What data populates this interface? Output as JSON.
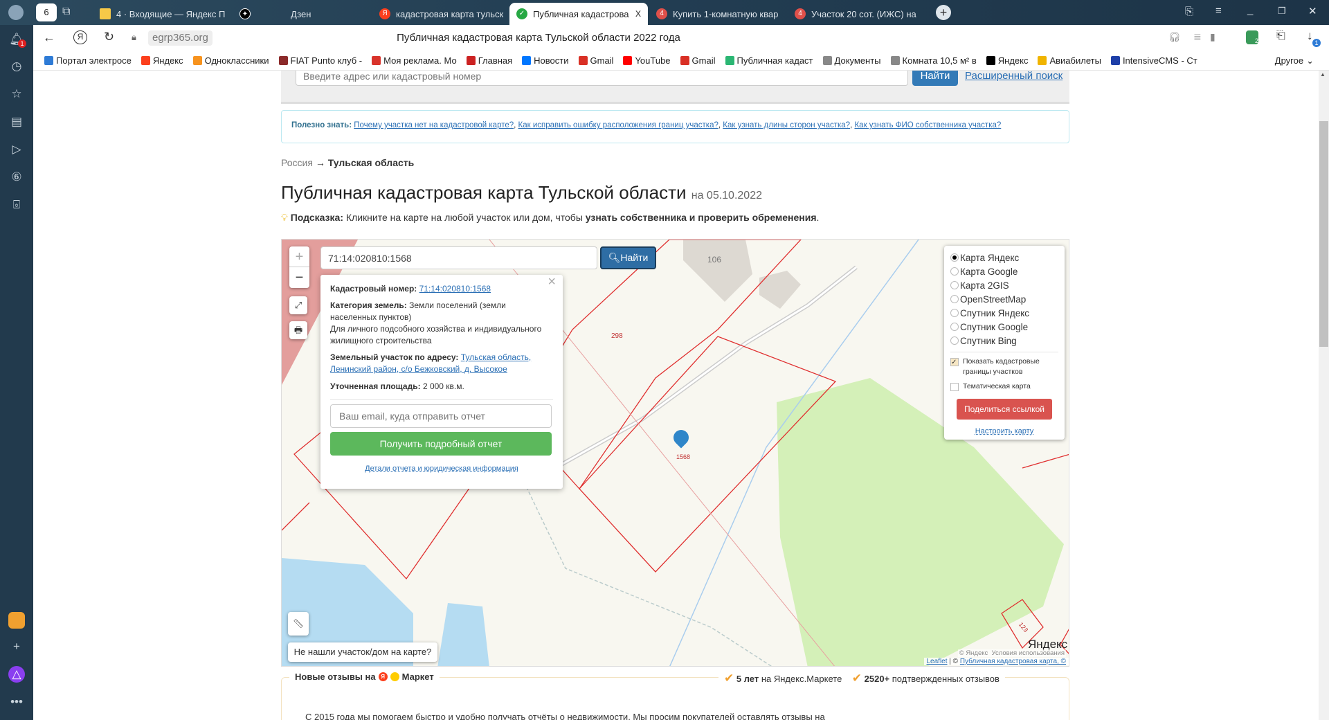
{
  "browser": {
    "tabs": [
      {
        "label": "4 · Входящие — Яндекс П",
        "color": "#f7c948"
      },
      {
        "label": "Дзен",
        "color": "#000000"
      },
      {
        "label": "кадастровая карта тульск",
        "color": "#fc3f1d"
      },
      {
        "label": "Публичная кадастрова",
        "color": "#27a844",
        "active": true
      },
      {
        "label": "Купить 1-комнатную квар",
        "color": "#e0504a"
      },
      {
        "label": "Участок 20 сот. (ИЖС) на",
        "color": "#e0504a"
      }
    ],
    "tab_close": "X",
    "url": "egrp365.org",
    "page_title": "Публичная кадастровая карта Тульской области 2022 года",
    "notification_count": "1",
    "download_count": "1",
    "ext_count": "2",
    "bookmarks": [
      {
        "label": "Портал электросе",
        "color": "#2e7bd6"
      },
      {
        "label": "Яндекс",
        "color": "#fc3f1d"
      },
      {
        "label": "Одноклассники",
        "color": "#f7931e"
      },
      {
        "label": "FIAT Punto клуб -",
        "color": "#8b2a2a"
      },
      {
        "label": "Моя реклама. Мо",
        "color": "#d9332b"
      },
      {
        "label": "Главная",
        "color": "#cc2222"
      },
      {
        "label": "Новости",
        "color": "#0077ff"
      },
      {
        "label": "Gmail",
        "color": "#d93025"
      },
      {
        "label": "YouTube",
        "color": "#ff0000"
      },
      {
        "label": "Gmail",
        "color": "#d93025"
      },
      {
        "label": "Публичная кадаст",
        "color": "#2bb673"
      },
      {
        "label": "Документы",
        "color": "#888888"
      },
      {
        "label": "Комната 10,5 м² в",
        "color": "#888888"
      },
      {
        "label": "Яндекс",
        "color": "#000000"
      },
      {
        "label": "Авиабилеты",
        "color": "#f0b400"
      },
      {
        "label": "IntensiveCMS - Ст",
        "color": "#1e3fa8"
      }
    ],
    "bookmarks_other": "Другое"
  },
  "search": {
    "placeholder": "Введите адрес или кадастровый номер",
    "button": "Найти",
    "advanced": "Расширенный поиск"
  },
  "useful": {
    "label": "Полезно знать:",
    "links": [
      "Почему участка нет на кадастровой карте?",
      "Как исправить ошибку расположения границ участка?",
      "Как узнать длины сторон участка?",
      "Как узнать ФИО собственника участка?"
    ]
  },
  "breadcrumb": {
    "root": "Россия",
    "arrow": "→",
    "current": "Тульская область"
  },
  "heading": {
    "title": "Публичная кадастровая карта Тульской области",
    "date": "на 05.10.2022"
  },
  "hint": {
    "label": "Подсказка:",
    "text": "Кликните на карте на любой участок или дом, чтобы ",
    "bold": "узнать собственника и проверить обременения",
    "end": "."
  },
  "map": {
    "search_value": "71:14:020810:1568",
    "search_button": "Найти",
    "zoom_in": "+",
    "zoom_out": "−",
    "labels": {
      "building": "106",
      "parcel_298": "298",
      "parcel_1568": "1568",
      "parcel_123": "123"
    },
    "popup": {
      "cad_label": "Кадастровый номер:",
      "cad_value": "71:14:020810:1568",
      "cat_label": "Категория земель:",
      "cat_value": "Земли поселений (земли населенных пунктов)",
      "use": "Для личного подсобного хозяйства и индивидуального жилищного строительства",
      "addr_label": "Земельный участок по адресу:",
      "addr_value": "Тульская область, Ленинский район, с/о Бежковский, д. Высокое",
      "area_label": "Уточненная площадь:",
      "area_value": "2 000 кв.м.",
      "email_placeholder": "Ваш email, куда отправить отчет",
      "report_button": "Получить подробный отчет",
      "details_link": "Детали отчета и юридическая информация",
      "close": "×"
    },
    "layers": {
      "options": [
        "Карта Яндекс",
        "Карта Google",
        "Карта 2GIS",
        "OpenStreetMap",
        "Спутник Яндекс",
        "Спутник Google",
        "Спутник Bing"
      ],
      "selected": 0,
      "show_borders": "Показать кадастровые границы участков",
      "thematic": "Тематическая карта",
      "share": "Поделиться ссылкой",
      "configure": "Настроить карту"
    },
    "not_found": "Не нашли участок/дом на карте?",
    "yandex_logo": "Яндекс",
    "attribution_leaflet": "Leaflet",
    "attribution_sep": " | © ",
    "attribution_pkk": "Публичная кадастровая карта, ©",
    "attribution_yandex": "© Яндекс  Условия использования"
  },
  "reviews": {
    "title_pre": "Новые отзывы на",
    "title_post": "Маркет",
    "years_bold": "5 лет",
    "years_text": " на Яндекс.Маркете",
    "count_bold": "2520+",
    "count_text": " подтвержденных отзывов",
    "body": "С 2015 года мы помогаем быстро и удобно получать отчёты о недвижимости. Мы просим покупателей оставлять отзывы на"
  }
}
